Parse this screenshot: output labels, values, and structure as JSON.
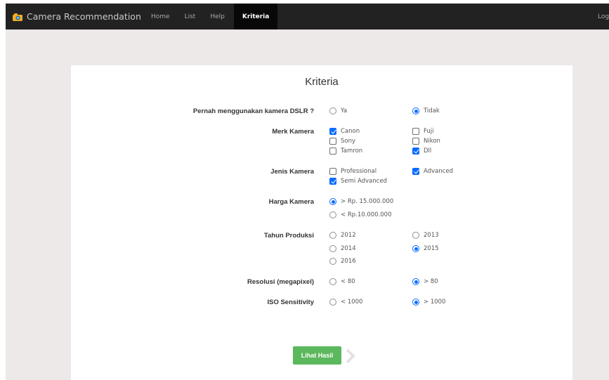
{
  "navbar": {
    "brand": "Camera Recommendation",
    "items": [
      "Home",
      "List",
      "Help",
      "Kriteria"
    ],
    "login": "Log"
  },
  "form": {
    "title": "Kriteria",
    "dslr": {
      "label": "Pernah menggunakan kamera DSLR ?",
      "options": [
        "Ya",
        "Tidak"
      ],
      "selected": "Tidak"
    },
    "merk": {
      "label": "Merk Kamera",
      "options": [
        "Canon",
        "Fuji",
        "Sony",
        "Nikon",
        "Tamron",
        "Dll"
      ],
      "checked": [
        "Canon",
        "Dll"
      ]
    },
    "jenis": {
      "label": "Jenis Kamera",
      "options": [
        "Professional",
        "Advanced",
        "Semi Advanced"
      ],
      "checked": [
        "Advanced",
        "Semi Advanced"
      ]
    },
    "harga": {
      "label": "Harga Kamera",
      "options": [
        "> Rp. 15.000.000",
        "< Rp.10.000.000"
      ],
      "selected": "> Rp. 15.000.000"
    },
    "tahun": {
      "label": "Tahun Produksi",
      "options": [
        "2012",
        "2013",
        "2014",
        "2015",
        "2016"
      ],
      "selected": "2015"
    },
    "resolusi": {
      "label": "Resolusi (megapixel)",
      "options": [
        "< 80",
        "> 80"
      ],
      "selected": "> 80"
    },
    "iso": {
      "label": "ISO Sensitivity",
      "options": [
        "< 1000",
        "> 1000"
      ],
      "selected": "> 1000"
    },
    "submit": "Lihat Hasil"
  },
  "colors": {
    "navbar": "#222222",
    "accent": "#0a6cff",
    "button": "#5cb85c",
    "background": "#ece9e8"
  },
  "icons": {
    "brand": "camera-icon",
    "next": "chevron-right-icon"
  }
}
